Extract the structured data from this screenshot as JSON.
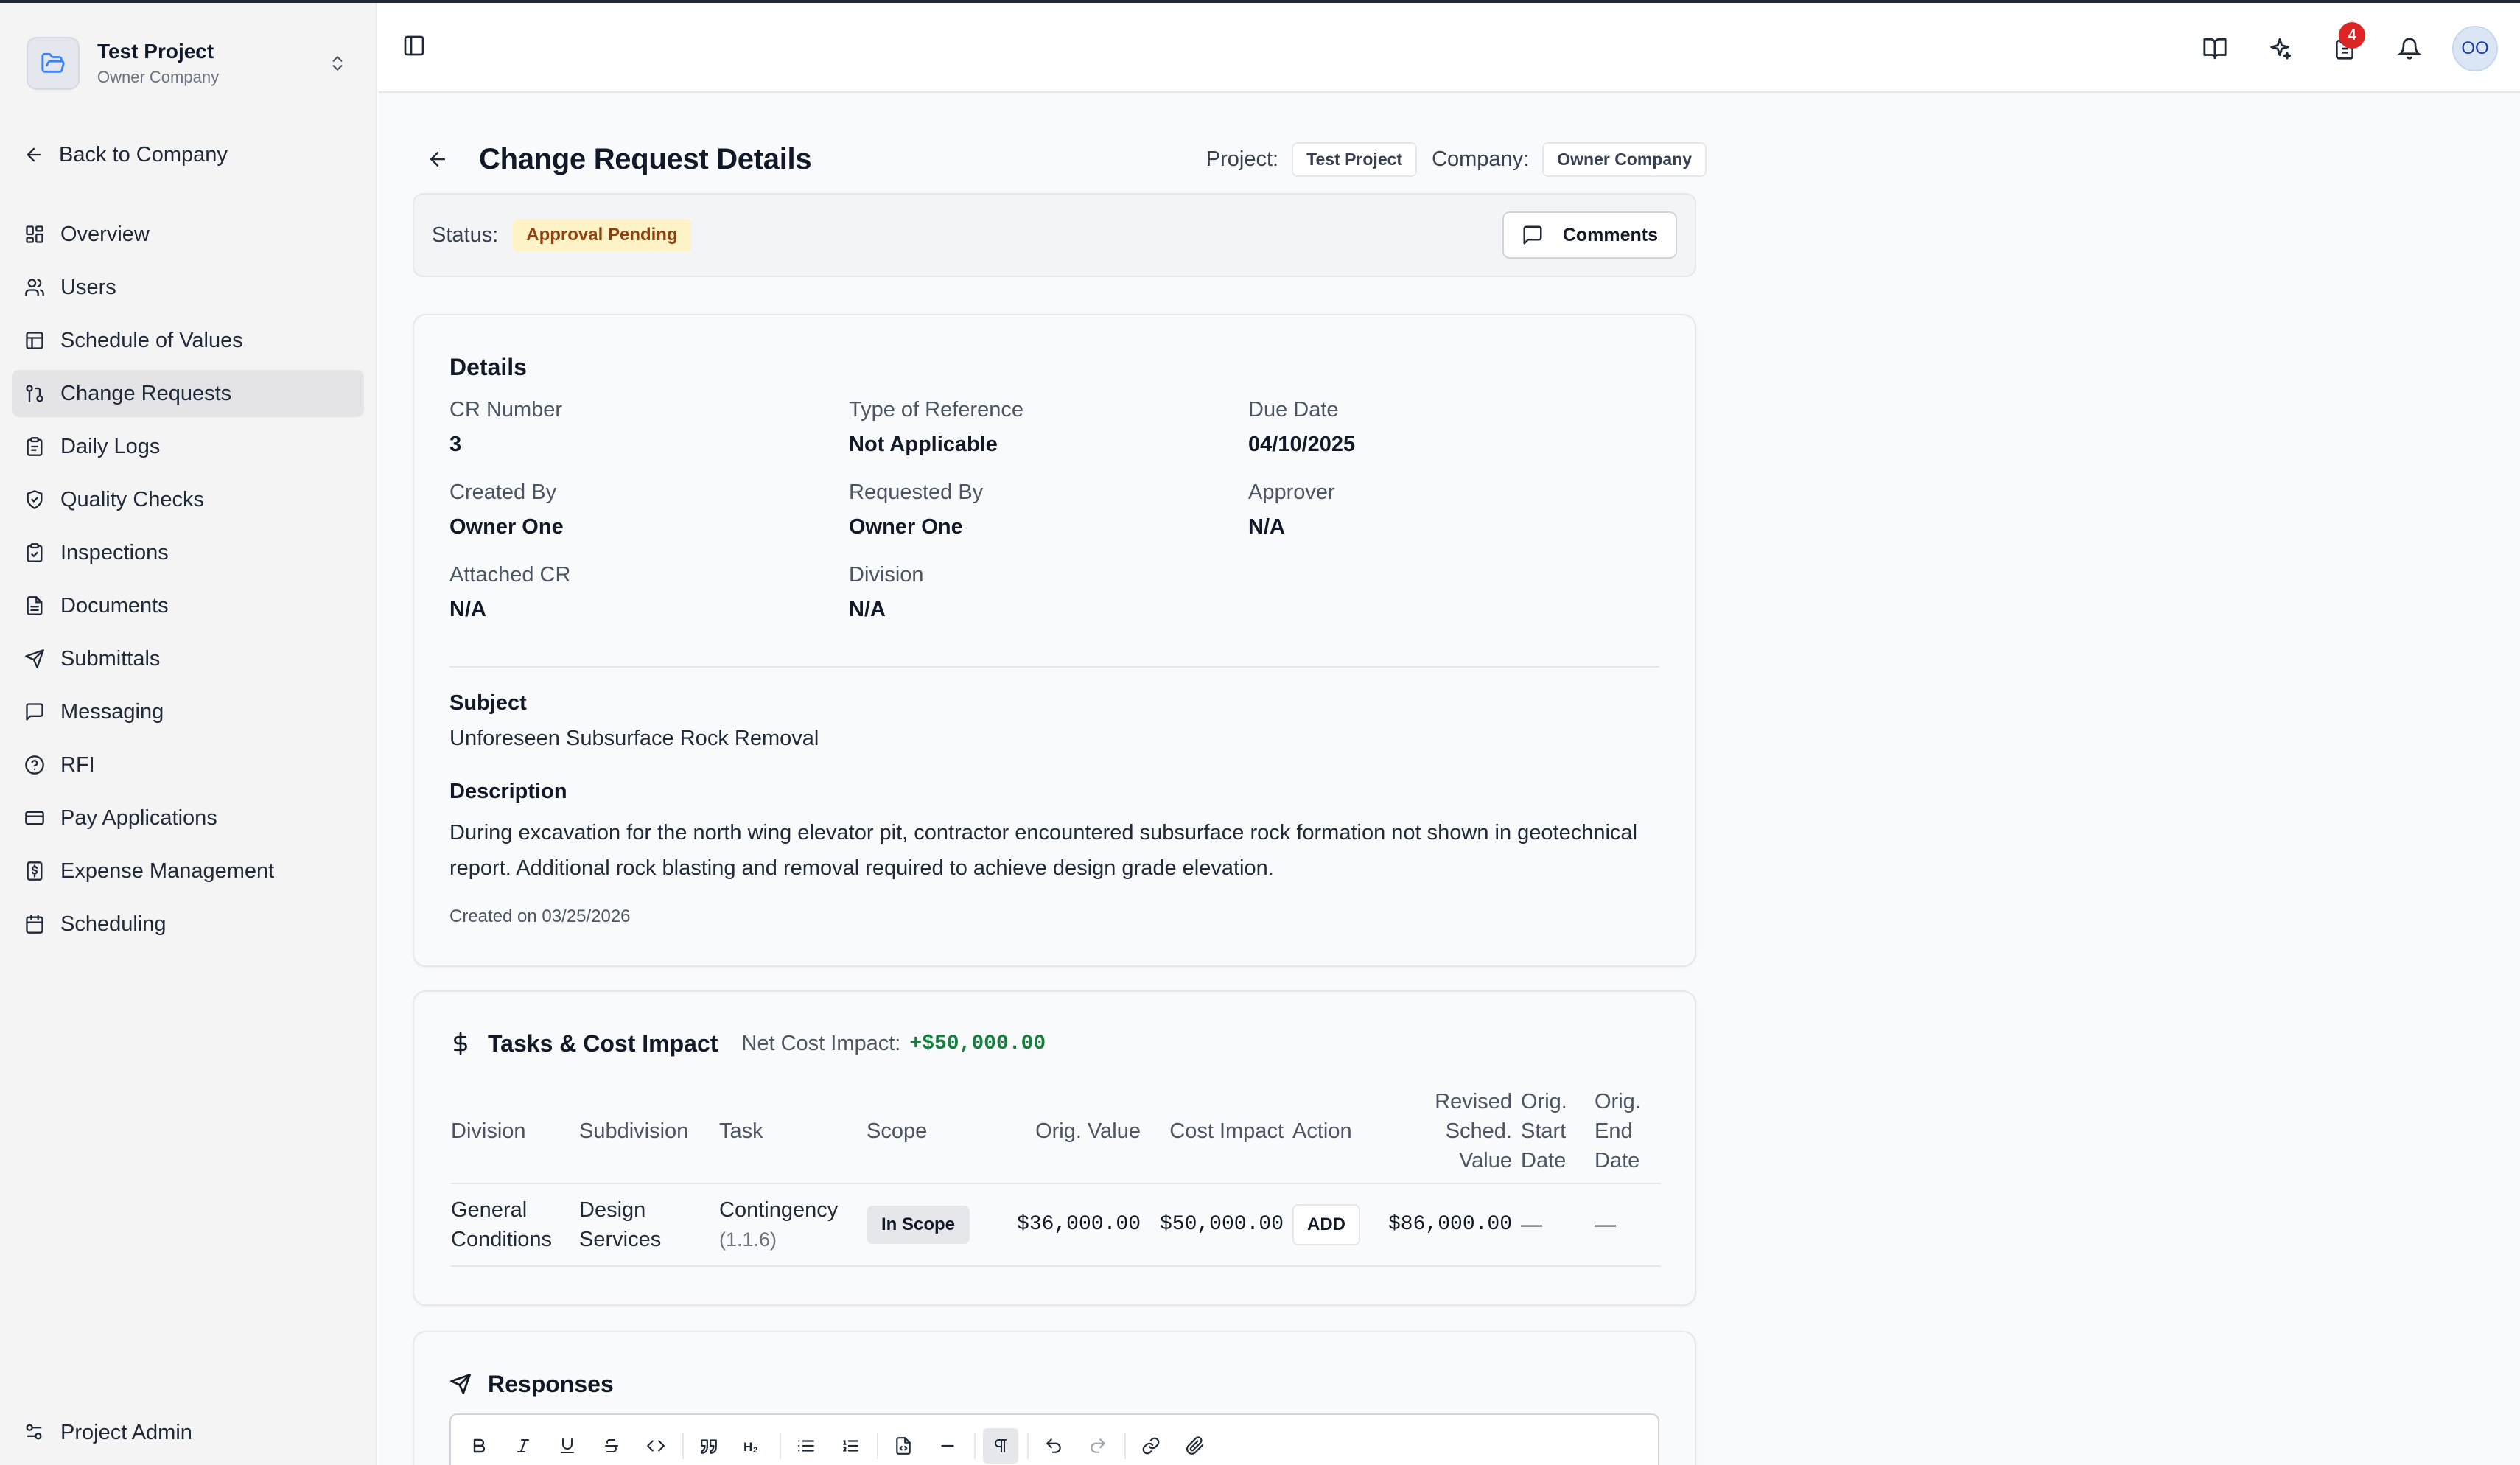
{
  "sidebar": {
    "project_name": "Test Project",
    "company_name": "Owner Company",
    "back_label": "Back to Company",
    "items": [
      {
        "label": "Overview",
        "icon": "layout-grid-icon"
      },
      {
        "label": "Users",
        "icon": "users-icon"
      },
      {
        "label": "Schedule of Values",
        "icon": "table-icon"
      },
      {
        "label": "Change Requests",
        "icon": "git-pull-request-icon",
        "active": true
      },
      {
        "label": "Daily Logs",
        "icon": "clipboard-icon"
      },
      {
        "label": "Quality Checks",
        "icon": "shield-check-icon"
      },
      {
        "label": "Inspections",
        "icon": "clipboard-check-icon"
      },
      {
        "label": "Documents",
        "icon": "file-text-icon"
      },
      {
        "label": "Submittals",
        "icon": "send-icon"
      },
      {
        "label": "Messaging",
        "icon": "message-square-icon"
      },
      {
        "label": "RFI",
        "icon": "help-circle-icon"
      },
      {
        "label": "Pay Applications",
        "icon": "credit-card-icon"
      },
      {
        "label": "Expense Management",
        "icon": "receipt-icon"
      },
      {
        "label": "Scheduling",
        "icon": "calendar-icon"
      }
    ],
    "admin_label": "Project Admin"
  },
  "topbar": {
    "notification_count": "4",
    "avatar_initials": "OO"
  },
  "header": {
    "title": "Change Request Details",
    "project_label": "Project:",
    "project_value": "Test Project",
    "company_label": "Company:",
    "company_value": "Owner Company"
  },
  "status": {
    "label": "Status:",
    "value": "Approval Pending",
    "comments_label": "Comments"
  },
  "details": {
    "title": "Details",
    "fields": [
      {
        "label": "CR Number",
        "value": "3"
      },
      {
        "label": "Type of Reference",
        "value": "Not Applicable"
      },
      {
        "label": "Due Date",
        "value": "04/10/2025"
      },
      {
        "label": "Created By",
        "value": "Owner One"
      },
      {
        "label": "Requested By",
        "value": "Owner One"
      },
      {
        "label": "Approver",
        "value": "N/A"
      },
      {
        "label": "Attached CR",
        "value": "N/A"
      },
      {
        "label": "Division",
        "value": "N/A"
      }
    ],
    "subject_label": "Subject",
    "subject_value": "Unforeseen Subsurface Rock Removal",
    "description_label": "Description",
    "description_value": "During excavation for the north wing elevator pit, contractor encountered subsurface rock formation not shown in geotechnical report. Additional rock blasting and removal required to achieve design grade elevation.",
    "created_on": "Created on 03/25/2026"
  },
  "tasks": {
    "title": "Tasks & Cost Impact",
    "net_label": "Net Cost Impact:",
    "net_value": "+$50,000.00",
    "columns": [
      "Division",
      "Subdivision",
      "Task",
      "Scope",
      "Orig. Value",
      "Cost Impact",
      "Action",
      "Revised Sched. Value",
      "Orig. Start Date",
      "Orig. End Date"
    ],
    "rows": [
      {
        "division": "General Conditions",
        "subdivision": "Design Services",
        "task": "Contingency",
        "task_code": "(1.1.6)",
        "scope": "In Scope",
        "orig_value": "$36,000.00",
        "cost_impact": "$50,000.00",
        "action": "ADD",
        "revised_value": "$86,000.00",
        "orig_start": "—",
        "orig_end": "—"
      }
    ]
  },
  "responses": {
    "title": "Responses",
    "toolbar": [
      "bold",
      "italic",
      "underline",
      "strikethrough",
      "code",
      "quote",
      "heading-2",
      "bullet-list",
      "ordered-list",
      "code-block",
      "horizontal-rule",
      "paragraph",
      "undo",
      "redo",
      "link",
      "attachment"
    ]
  }
}
